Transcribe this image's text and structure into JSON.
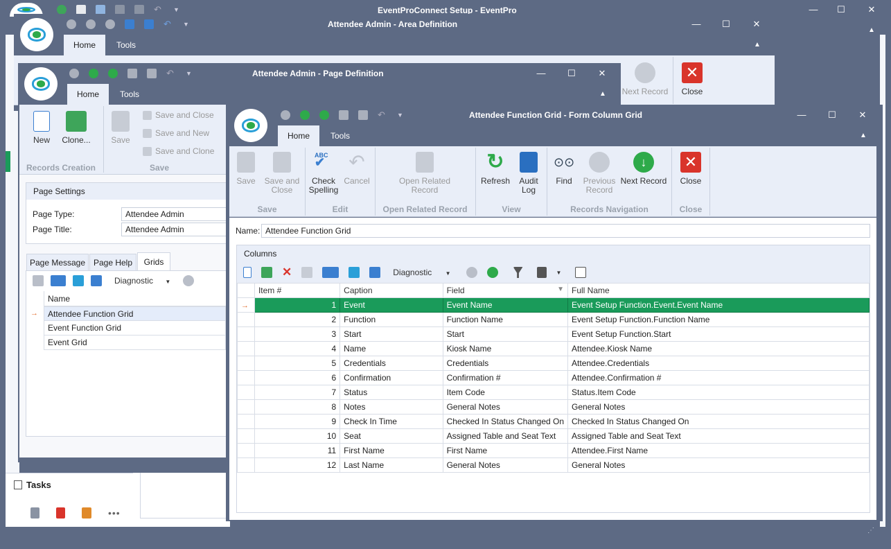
{
  "main_window": {
    "title": "EventProConnect Setup - EventPro"
  },
  "area_window": {
    "title": "Attendee Admin - Area Definition",
    "tab_home": "Home",
    "tab_tools": "Tools",
    "next_record": "Next Record",
    "close": "Close"
  },
  "page_window": {
    "title": "Attendee Admin - Page Definition",
    "tab_home": "Home",
    "tab_tools": "Tools",
    "buttons": {
      "new": "New",
      "clone": "Clone...",
      "save": "Save",
      "save_and_close": "Save and Close",
      "save_and_new": "Save and New",
      "save_and_clone": "Save and Clone"
    },
    "groups": {
      "records_creation": "Records Creation",
      "save": "Save"
    },
    "settings_header": "Page Settings",
    "page_type_label": "Page Type:",
    "page_type_value": "Attendee Admin",
    "page_title_label": "Page Title:",
    "page_title_value": "Attendee Admin",
    "subtabs": [
      "Page Message",
      "Page Help",
      "Grids"
    ],
    "diagnostic": "Diagnostic",
    "name_header": "Name",
    "grids": [
      "Attendee Function Grid",
      "Event Function Grid",
      "Event Grid"
    ]
  },
  "tasks": {
    "label": "Tasks"
  },
  "form_window": {
    "title": "Attendee Function Grid - Form Column Grid",
    "tab_home": "Home",
    "tab_tools": "Tools",
    "buttons": {
      "save": "Save",
      "save_and_close": "Save and Close",
      "check_spelling": "Check Spelling",
      "cancel": "Cancel",
      "open_related_record": "Open Related Record",
      "refresh": "Refresh",
      "audit_log": "Audit Log",
      "find": "Find",
      "previous_record": "Previous Record",
      "next_record": "Next Record",
      "close": "Close"
    },
    "groups": {
      "save": "Save",
      "edit": "Edit",
      "open_related_record": "Open Related Record",
      "view": "View",
      "records_navigation": "Records Navigation",
      "close": "Close"
    },
    "name_label": "Name:",
    "name_value": "Attendee Function Grid",
    "columns_header": "Columns",
    "diagnostic": "Diagnostic",
    "headers": {
      "item": "Item #",
      "caption": "Caption",
      "field": "Field",
      "full_name": "Full Name"
    },
    "rows": [
      {
        "item": "1",
        "caption": "Event",
        "field": "Event Name",
        "full": "Event Setup Function.Event.Event Name"
      },
      {
        "item": "2",
        "caption": "Function",
        "field": "Function Name",
        "full": "Event Setup Function.Function Name"
      },
      {
        "item": "3",
        "caption": "Start",
        "field": "Start",
        "full": "Event Setup Function.Start"
      },
      {
        "item": "4",
        "caption": "Name",
        "field": "Kiosk Name",
        "full": "Attendee.Kiosk Name"
      },
      {
        "item": "5",
        "caption": "Credentials",
        "field": "Credentials",
        "full": "Attendee.Credentials"
      },
      {
        "item": "6",
        "caption": "Confirmation",
        "field": "Confirmation #",
        "full": "Attendee.Confirmation #"
      },
      {
        "item": "7",
        "caption": "Status",
        "field": "Item Code",
        "full": "Status.Item Code"
      },
      {
        "item": "8",
        "caption": "Notes",
        "field": "General Notes",
        "full": "General Notes"
      },
      {
        "item": "9",
        "caption": "Check In Time",
        "field": "Checked In Status Changed On",
        "full": "Checked In Status Changed On"
      },
      {
        "item": "10",
        "caption": "Seat",
        "field": "Assigned Table and Seat Text",
        "full": "Assigned Table and Seat Text"
      },
      {
        "item": "11",
        "caption": "First Name",
        "field": "First Name",
        "full": "Attendee.First Name"
      },
      {
        "item": "12",
        "caption": "Last Name",
        "field": "General Notes",
        "full": "General Notes"
      }
    ]
  },
  "colors": {
    "accent": "#1a9b5a",
    "titlebar": "#5d6a84",
    "ribbon": "#e9eef8",
    "close_red": "#d9342b"
  }
}
